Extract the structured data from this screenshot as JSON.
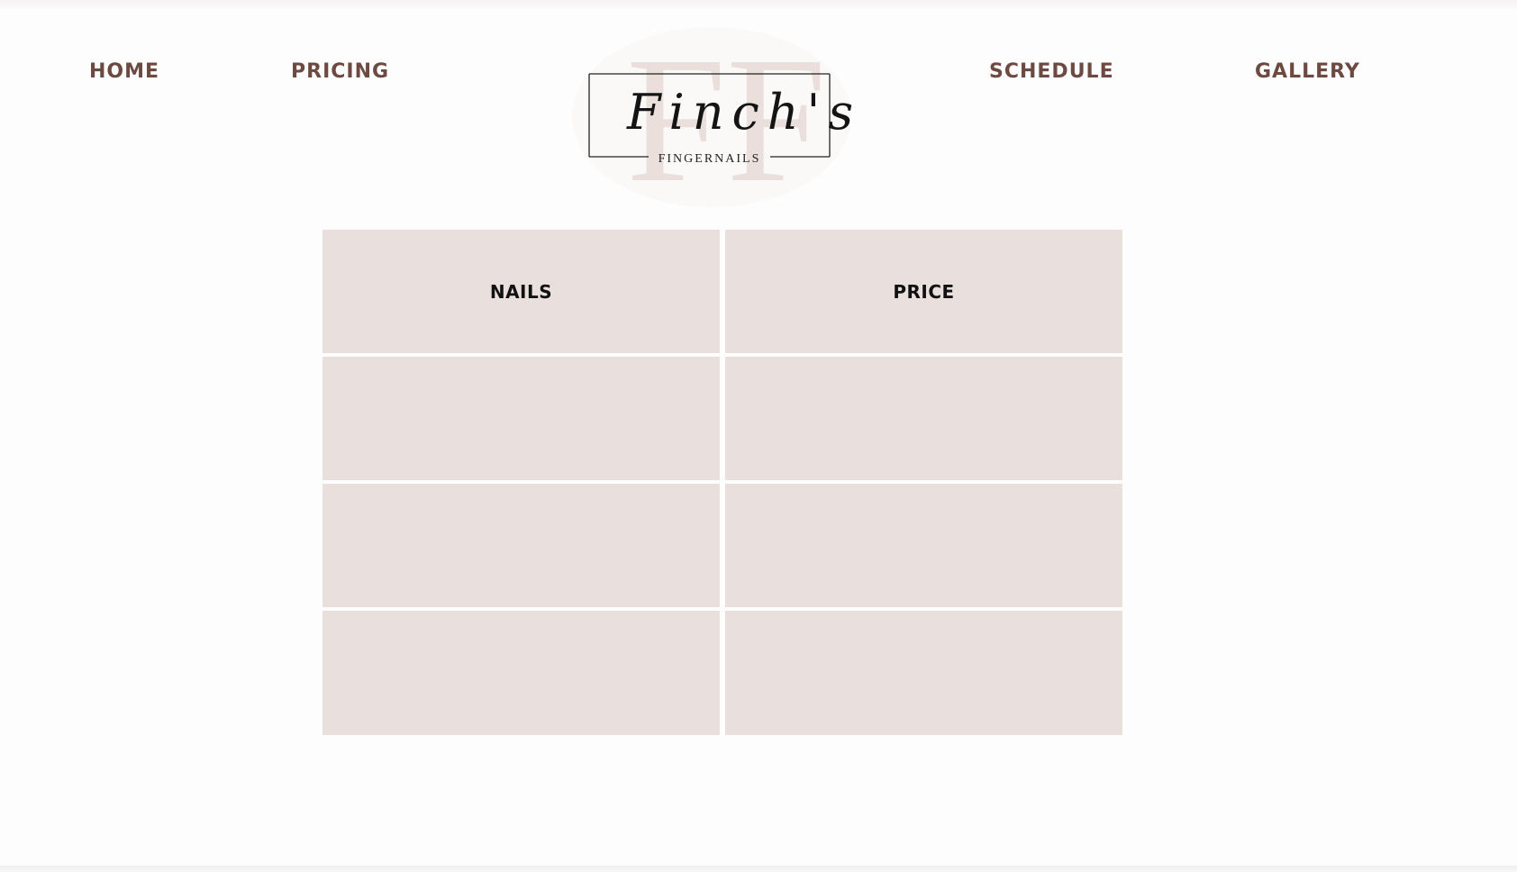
{
  "nav": {
    "home": "HOME",
    "pricing": "PRICING",
    "schedule": "SCHEDULE",
    "gallery": "GALLERY"
  },
  "logo": {
    "monogram": "FF",
    "script": "Finch's",
    "wordmark": "FINGERNAILS"
  },
  "pricing_table": {
    "headers": [
      "NAILS",
      "PRICE"
    ],
    "rows": [
      [
        "",
        ""
      ],
      [
        "",
        ""
      ],
      [
        "",
        ""
      ]
    ]
  },
  "colors": {
    "nav_text": "#6d4a41",
    "cell_background": "#e9e0dd",
    "page_background": "#fefdfd",
    "monogram": "#eadfdb",
    "header_text": "#111111"
  }
}
